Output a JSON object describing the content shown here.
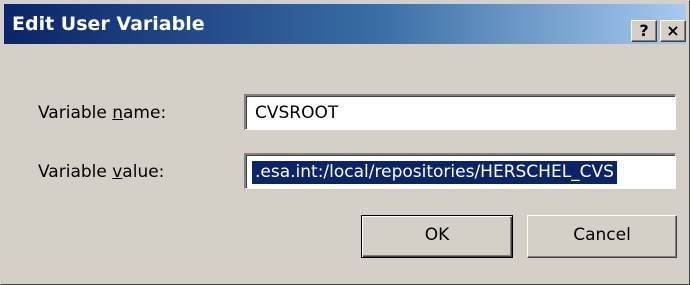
{
  "window": {
    "title": "Edit User Variable",
    "help_glyph": "?",
    "close_glyph": "×"
  },
  "form": {
    "name_label_pre": "Variable ",
    "name_label_accel": "n",
    "name_label_post": "ame:",
    "name_value": "CVSROOT",
    "value_label_pre": "Variable ",
    "value_label_accel": "v",
    "value_label_post": "alue:",
    "value_value": ".esa.int:/local/repositories/HERSCHEL_CVS"
  },
  "buttons": {
    "ok_label": "OK",
    "cancel_label": "Cancel"
  },
  "colors": {
    "titlebar_start": "#0a246a",
    "titlebar_end": "#a6caf0",
    "selection": "#0a246a",
    "face": "#d4d0c8"
  }
}
